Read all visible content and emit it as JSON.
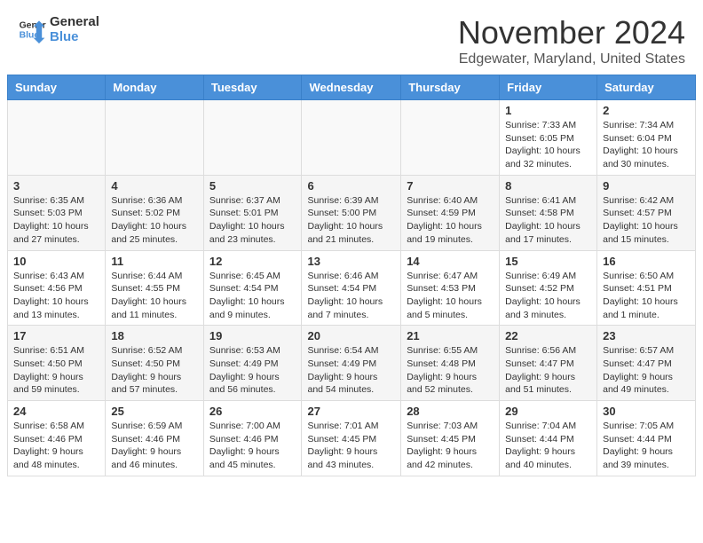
{
  "header": {
    "logo_line1": "General",
    "logo_line2": "Blue",
    "month_title": "November 2024",
    "location": "Edgewater, Maryland, United States"
  },
  "weekdays": [
    "Sunday",
    "Monday",
    "Tuesday",
    "Wednesday",
    "Thursday",
    "Friday",
    "Saturday"
  ],
  "weeks": [
    [
      {
        "day": "",
        "info": ""
      },
      {
        "day": "",
        "info": ""
      },
      {
        "day": "",
        "info": ""
      },
      {
        "day": "",
        "info": ""
      },
      {
        "day": "",
        "info": ""
      },
      {
        "day": "1",
        "info": "Sunrise: 7:33 AM\nSunset: 6:05 PM\nDaylight: 10 hours and 32 minutes."
      },
      {
        "day": "2",
        "info": "Sunrise: 7:34 AM\nSunset: 6:04 PM\nDaylight: 10 hours and 30 minutes."
      }
    ],
    [
      {
        "day": "3",
        "info": "Sunrise: 6:35 AM\nSunset: 5:03 PM\nDaylight: 10 hours and 27 minutes."
      },
      {
        "day": "4",
        "info": "Sunrise: 6:36 AM\nSunset: 5:02 PM\nDaylight: 10 hours and 25 minutes."
      },
      {
        "day": "5",
        "info": "Sunrise: 6:37 AM\nSunset: 5:01 PM\nDaylight: 10 hours and 23 minutes."
      },
      {
        "day": "6",
        "info": "Sunrise: 6:39 AM\nSunset: 5:00 PM\nDaylight: 10 hours and 21 minutes."
      },
      {
        "day": "7",
        "info": "Sunrise: 6:40 AM\nSunset: 4:59 PM\nDaylight: 10 hours and 19 minutes."
      },
      {
        "day": "8",
        "info": "Sunrise: 6:41 AM\nSunset: 4:58 PM\nDaylight: 10 hours and 17 minutes."
      },
      {
        "day": "9",
        "info": "Sunrise: 6:42 AM\nSunset: 4:57 PM\nDaylight: 10 hours and 15 minutes."
      }
    ],
    [
      {
        "day": "10",
        "info": "Sunrise: 6:43 AM\nSunset: 4:56 PM\nDaylight: 10 hours and 13 minutes."
      },
      {
        "day": "11",
        "info": "Sunrise: 6:44 AM\nSunset: 4:55 PM\nDaylight: 10 hours and 11 minutes."
      },
      {
        "day": "12",
        "info": "Sunrise: 6:45 AM\nSunset: 4:54 PM\nDaylight: 10 hours and 9 minutes."
      },
      {
        "day": "13",
        "info": "Sunrise: 6:46 AM\nSunset: 4:54 PM\nDaylight: 10 hours and 7 minutes."
      },
      {
        "day": "14",
        "info": "Sunrise: 6:47 AM\nSunset: 4:53 PM\nDaylight: 10 hours and 5 minutes."
      },
      {
        "day": "15",
        "info": "Sunrise: 6:49 AM\nSunset: 4:52 PM\nDaylight: 10 hours and 3 minutes."
      },
      {
        "day": "16",
        "info": "Sunrise: 6:50 AM\nSunset: 4:51 PM\nDaylight: 10 hours and 1 minute."
      }
    ],
    [
      {
        "day": "17",
        "info": "Sunrise: 6:51 AM\nSunset: 4:50 PM\nDaylight: 9 hours and 59 minutes."
      },
      {
        "day": "18",
        "info": "Sunrise: 6:52 AM\nSunset: 4:50 PM\nDaylight: 9 hours and 57 minutes."
      },
      {
        "day": "19",
        "info": "Sunrise: 6:53 AM\nSunset: 4:49 PM\nDaylight: 9 hours and 56 minutes."
      },
      {
        "day": "20",
        "info": "Sunrise: 6:54 AM\nSunset: 4:49 PM\nDaylight: 9 hours and 54 minutes."
      },
      {
        "day": "21",
        "info": "Sunrise: 6:55 AM\nSunset: 4:48 PM\nDaylight: 9 hours and 52 minutes."
      },
      {
        "day": "22",
        "info": "Sunrise: 6:56 AM\nSunset: 4:47 PM\nDaylight: 9 hours and 51 minutes."
      },
      {
        "day": "23",
        "info": "Sunrise: 6:57 AM\nSunset: 4:47 PM\nDaylight: 9 hours and 49 minutes."
      }
    ],
    [
      {
        "day": "24",
        "info": "Sunrise: 6:58 AM\nSunset: 4:46 PM\nDaylight: 9 hours and 48 minutes."
      },
      {
        "day": "25",
        "info": "Sunrise: 6:59 AM\nSunset: 4:46 PM\nDaylight: 9 hours and 46 minutes."
      },
      {
        "day": "26",
        "info": "Sunrise: 7:00 AM\nSunset: 4:46 PM\nDaylight: 9 hours and 45 minutes."
      },
      {
        "day": "27",
        "info": "Sunrise: 7:01 AM\nSunset: 4:45 PM\nDaylight: 9 hours and 43 minutes."
      },
      {
        "day": "28",
        "info": "Sunrise: 7:03 AM\nSunset: 4:45 PM\nDaylight: 9 hours and 42 minutes."
      },
      {
        "day": "29",
        "info": "Sunrise: 7:04 AM\nSunset: 4:44 PM\nDaylight: 9 hours and 40 minutes."
      },
      {
        "day": "30",
        "info": "Sunrise: 7:05 AM\nSunset: 4:44 PM\nDaylight: 9 hours and 39 minutes."
      }
    ]
  ]
}
